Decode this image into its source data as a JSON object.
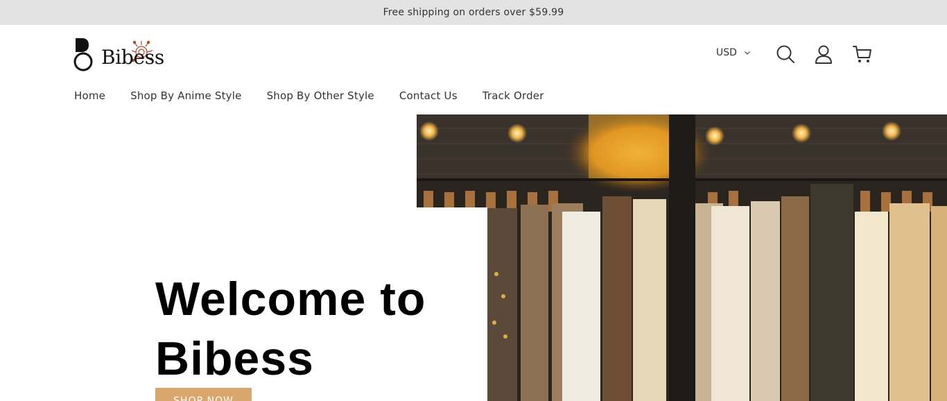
{
  "announcement": {
    "text": "Free shipping on orders over $59.99"
  },
  "header": {
    "logo_text": "Bibess",
    "currency": "USD",
    "icons": {
      "search": "search-icon",
      "account": "account-icon",
      "cart": "cart-icon",
      "dropdown": "chevron-down-icon"
    }
  },
  "nav": {
    "items": [
      {
        "label": "Home"
      },
      {
        "label": "Shop By Anime Style"
      },
      {
        "label": "Shop By Other Style"
      },
      {
        "label": "Contact Us"
      },
      {
        "label": "Track Order"
      }
    ]
  },
  "hero": {
    "title": "Welcome to Bibess",
    "button_label": "SHOP NOW"
  },
  "colors": {
    "announcement_bg": "#e3e3e3",
    "button_bg": "#d9a66b",
    "title": "#000000"
  }
}
